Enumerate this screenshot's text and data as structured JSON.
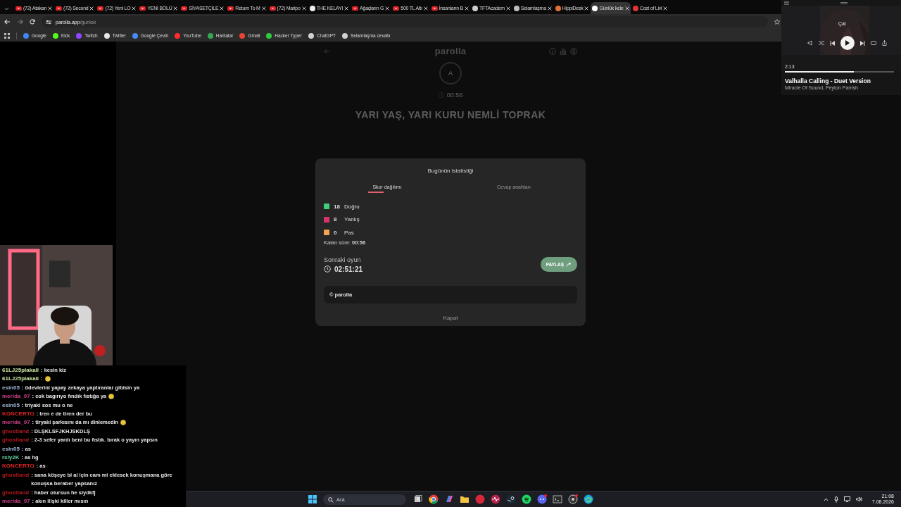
{
  "browser": {
    "tabs": [
      {
        "title": "(72) Atakan",
        "kind": "youtube",
        "selected": false
      },
      {
        "title": "(72) Second",
        "kind": "youtube",
        "selected": false
      },
      {
        "title": "(72) Yeni LO",
        "kind": "youtube",
        "selected": false
      },
      {
        "title": "YENİ BÖLÜ",
        "kind": "youtube",
        "selected": false
      },
      {
        "title": "SİYASETÇİLE",
        "kind": "youtube",
        "selected": false
      },
      {
        "title": "Return To M",
        "kind": "youtube",
        "selected": false
      },
      {
        "title": "(72) Maripo",
        "kind": "youtube",
        "selected": false
      },
      {
        "title": "THE KELAYI",
        "kind": "site",
        "color": "#f0f0f0",
        "selected": false
      },
      {
        "title": "Ağaçların G",
        "kind": "youtube",
        "selected": false
      },
      {
        "title": "500 TL Altı",
        "kind": "youtube",
        "selected": false
      },
      {
        "title": "İnsanların B",
        "kind": "youtube",
        "selected": false
      },
      {
        "title": "TFTAcadem",
        "kind": "site",
        "color": "#cfcfcf",
        "selected": false
      },
      {
        "title": "Selamlaşma",
        "kind": "site",
        "color": "#bdbdbd",
        "selected": false
      },
      {
        "title": "HippiDesk",
        "kind": "site",
        "color": "#e0703a",
        "selected": false
      },
      {
        "title": "Günlük kele",
        "kind": "site",
        "color": "#ffffff",
        "selected": true
      },
      {
        "title": "Cost of Livi",
        "kind": "site",
        "color": "#e03434",
        "selected": false
      }
    ],
    "address": {
      "host": "parolla.app",
      "path": "/gunluk"
    },
    "bookmarks": [
      {
        "label": "Google",
        "color": "#4285f4"
      },
      {
        "label": "Kick",
        "color": "#53fc18"
      },
      {
        "label": "Twitch",
        "color": "#9146ff"
      },
      {
        "label": "Twitter",
        "color": "#e7e7e7"
      },
      {
        "label": "Google Çeviri",
        "color": "#4a8af4"
      },
      {
        "label": "YouTube",
        "color": "#ff2d2d"
      },
      {
        "label": "Haritalar",
        "color": "#34a853"
      },
      {
        "label": "Gmail",
        "color": "#ea4335"
      },
      {
        "label": "Hacker Typer",
        "color": "#2ecc40"
      },
      {
        "label": "ChatGPT",
        "color": "#d0d0d0"
      },
      {
        "label": "Selamlaşma cevabı",
        "color": "#d0d0d0"
      }
    ]
  },
  "game": {
    "logo": "parolla",
    "letter": "A",
    "timer": "00:56",
    "question": "YARI YAŞ, YARI KURU NEMLİ TOPRAK"
  },
  "stats_dialog": {
    "title": "Bugünün istatistiği",
    "tabs": [
      {
        "label": "Skor dağılımı",
        "selected": true
      },
      {
        "label": "Cevap anahtarı",
        "selected": false
      }
    ],
    "scores": [
      {
        "count": "18",
        "label": "Doğru",
        "color": "#3ecf7a"
      },
      {
        "count": "8",
        "label": "Yanlış",
        "color": "#d6336c"
      },
      {
        "count": "0",
        "label": "Pas",
        "color": "#f5a052"
      }
    ],
    "remaining": "Kalan süre: **00:56**",
    "next_label": "Sonraki oyun",
    "next_time": "02:51:21",
    "share_button": "PAYLAŞ",
    "footer": "© parolla",
    "close_button": "Kapat"
  },
  "music_player": {
    "tooltip": "Çal",
    "elapsed": "2:13",
    "level": 0.63,
    "title": "Valhalla Calling - Duet Version",
    "artist": "Miracle Of Sound, Peyton Parrish"
  },
  "chat": {
    "messages": [
      {
        "user": "61LJ25plakali",
        "color": "#c9e3a0",
        "text": ": kesin kiz",
        "emote": false
      },
      {
        "user": "61LJ25plakali",
        "color": "#c9e3a0",
        "text": ":",
        "emote": true
      },
      {
        "user": "esin05",
        "color": "#9fb8d8",
        "text": ": ödevlerini yapay zekaya yaptıranlar gibisin ya",
        "emote": false
      },
      {
        "user": "merida_97",
        "color": "#c8408a",
        "text": ": cok bagırıyo fındık fıstığa ya",
        "emote": true
      },
      {
        "user": "esin05",
        "color": "#9fb8d8",
        "text": ": triyaki sos mu o ne",
        "emote": false
      },
      {
        "user": "KONCERTO",
        "color": "#e02424",
        "text": ": tren e de tiren der bu",
        "emote": false
      },
      {
        "user": "merida_97",
        "color": "#c8408a",
        "text": ": tiryaki şarkısını da mı dinlemedin",
        "emote": true
      },
      {
        "user": "ghostland",
        "color": "#b3191f",
        "text": ": DLŞKLSFJKHJSKDLŞ",
        "emote": false
      },
      {
        "user": "ghostland",
        "color": "#b3191f",
        "text": ": 2-3 sefer yardı beni bu fıstık. bırak o yayın yapsın",
        "emote": false
      },
      {
        "user": "esin05",
        "color": "#9fb8d8",
        "text": ": as",
        "emote": false
      },
      {
        "user": "rsly2K",
        "color": "#5fd6a4",
        "text": ": as hg",
        "emote": false
      },
      {
        "user": "KONCERTO",
        "color": "#e02424",
        "text": ": as",
        "emote": false
      },
      {
        "user": "ghostland",
        "color": "#b3191f",
        "text": ": sana köşeye bi ai için cam mi eklesek konuşmana göre konuşsa beraber yapsanız",
        "emote": false
      },
      {
        "user": "ghostland",
        "color": "#b3191f",
        "text": ": haber olursun he siydkfj",
        "emote": false
      },
      {
        "user": "merida_97",
        "color": "#c8408a",
        "text": ": akın ilişki killer mısın",
        "emote": false
      }
    ]
  },
  "taskbar": {
    "search_placeholder": "Ara",
    "time": "21:08",
    "date": "7.08.2026"
  }
}
